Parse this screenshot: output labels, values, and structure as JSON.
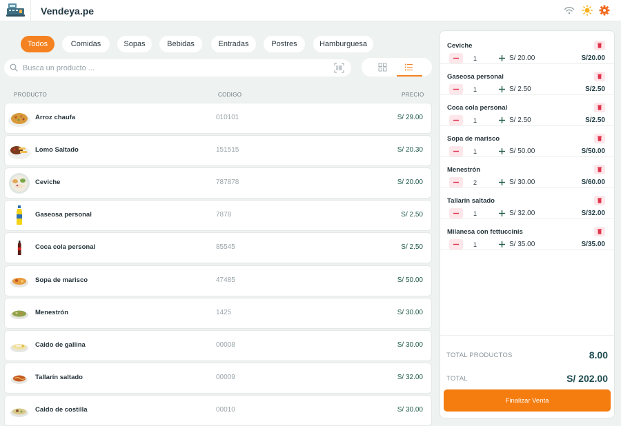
{
  "app": {
    "brand": "Vendeya.pe"
  },
  "categories": [
    "Todos",
    "Comidas",
    "Sopas",
    "Bebidas",
    "Entradas",
    "Postres",
    "Hamburguesa"
  ],
  "search": {
    "placeholder": "Busca un producto ..."
  },
  "table": {
    "headers": {
      "product": "PRODUCTO",
      "code": "CODIGO",
      "price": "PRECIO"
    }
  },
  "products": [
    {
      "name": "Arroz chaufa",
      "code": "010101",
      "price": "S/ 29.00"
    },
    {
      "name": "Lomo Saltado",
      "code": "151515",
      "price": "S/ 20.30"
    },
    {
      "name": "Ceviche",
      "code": "787878",
      "price": "S/ 20.00"
    },
    {
      "name": "Gaseosa personal",
      "code": "7878",
      "price": "S/ 2.50"
    },
    {
      "name": "Coca cola personal",
      "code": "85545",
      "price": "S/ 2.50"
    },
    {
      "name": "Sopa de marisco",
      "code": "47485",
      "price": "S/ 50.00"
    },
    {
      "name": "Menestrón",
      "code": "1425",
      "price": "S/ 30.00"
    },
    {
      "name": "Caldo de gallina",
      "code": "00008",
      "price": "S/ 30.00"
    },
    {
      "name": "Tallarín saltado",
      "code": "00009",
      "price": "S/ 32.00"
    },
    {
      "name": "Caldo de costilla",
      "code": "00010",
      "price": "S/ 30.00"
    }
  ],
  "cart": {
    "items": [
      {
        "name": "Ceviche",
        "qty": "1",
        "unit": "S/ 20.00",
        "total": "S/20.00"
      },
      {
        "name": "Gaseosa personal",
        "qty": "1",
        "unit": "S/ 2.50",
        "total": "S/2.50"
      },
      {
        "name": "Coca cola personal",
        "qty": "1",
        "unit": "S/ 2.50",
        "total": "S/2.50"
      },
      {
        "name": "Sopa de marisco",
        "qty": "1",
        "unit": "S/ 50.00",
        "total": "S/50.00"
      },
      {
        "name": "Menestrón",
        "qty": "2",
        "unit": "S/ 30.00",
        "total": "S/60.00"
      },
      {
        "name": "Tallarín saltado",
        "qty": "1",
        "unit": "S/ 32.00",
        "total": "S/32.00"
      },
      {
        "name": "Milanesa con fettuccinis",
        "qty": "1",
        "unit": "S/ 35.00",
        "total": "S/35.00"
      }
    ],
    "total_products_label": "TOTAL PRODUCTOS",
    "total_products_value": "8.00",
    "total_label": "TOTAL",
    "total_value": "S/ 202.00",
    "finalize_label": "Finalizar Venta"
  },
  "icons": {
    "logo": "cash-register-icon",
    "wifi": "wifi-icon",
    "theme": "sun-icon",
    "settings": "gear-icon",
    "search": "search-icon",
    "barcode": "barcode-icon",
    "grid": "grid-view-icon",
    "list": "list-view-icon",
    "trash": "trash-icon",
    "minus": "minus-icon",
    "plus": "plus-icon"
  },
  "colors": {
    "accent": "#f58220",
    "danger": "#e0324b",
    "price_text": "#1d5a4a",
    "background": "#eef2f0"
  }
}
